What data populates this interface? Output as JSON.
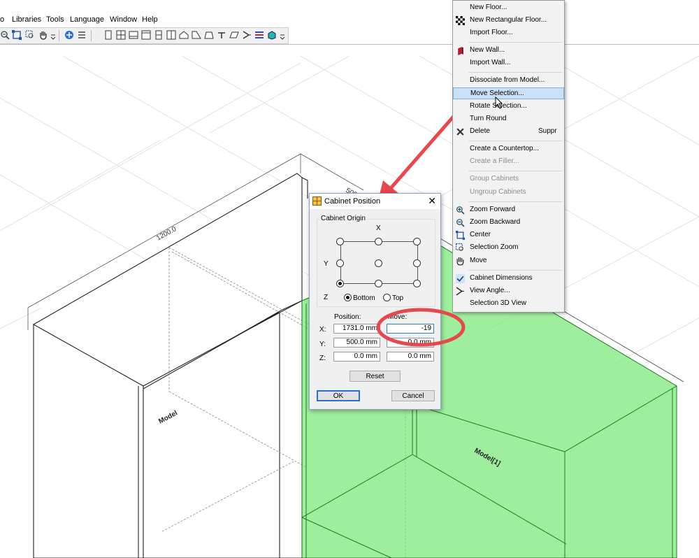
{
  "menubar": {
    "items": [
      "o",
      "Libraries",
      "Tools",
      "Language",
      "Window",
      "Help"
    ]
  },
  "toolbar": {
    "icons": [
      "zoom-out-icon",
      "center-icon",
      "hand-icon",
      "grip-icon",
      "view-icon",
      "list-icon",
      "cabinet-1-icon",
      "cabinet-2-icon",
      "cabinet-3-icon",
      "cabinet-4-icon",
      "cabinet-5-icon",
      "cabinet-6-icon",
      "roof-icon",
      "shape-icon",
      "trapezoid-icon",
      "tap-icon",
      "parallelogram-icon",
      "angle-icon",
      "layers-icon",
      "box-3d-icon",
      "grip2-icon"
    ]
  },
  "canvas": {
    "dim_1200": "1200.0",
    "dim_500": "500.0",
    "model_label": "Model",
    "model1_label": "Model[1]",
    "green_fill": "#7ee87e",
    "annotation_color": "#e5484d"
  },
  "dialog": {
    "title": "Cabinet Position",
    "close": "✕",
    "origin_group": "Cabinet Origin",
    "axis_x": "X",
    "axis_y": "Y",
    "axis_z": "Z",
    "bottom": "Bottom",
    "top": "Top",
    "position_header": "Position:",
    "move_header": "Move:",
    "row_labels": [
      "X:",
      "Y:",
      "Z:"
    ],
    "position_values": [
      "1731.0 mm",
      "500.0 mm",
      "0.0 mm"
    ],
    "move_values": [
      "-19",
      "0.0 mm",
      "0.0 mm"
    ],
    "reset": "Reset",
    "ok": "OK",
    "cancel": "Cancel"
  },
  "menu": {
    "items": [
      {
        "label": "New Floor...",
        "shortcut": "",
        "disabled": false,
        "icon": ""
      },
      {
        "label": "New Rectangular Floor...",
        "shortcut": "",
        "disabled": false,
        "icon": "checker-icon"
      },
      {
        "label": "Import Floor...",
        "shortcut": "",
        "disabled": false,
        "icon": ""
      },
      {
        "label": "New Wall...",
        "shortcut": "",
        "disabled": false,
        "icon": "wall-icon"
      },
      {
        "label": "Import Wall...",
        "shortcut": "",
        "disabled": false,
        "icon": ""
      },
      {
        "label": "Dissociate from Model...",
        "shortcut": "",
        "disabled": false,
        "icon": ""
      },
      {
        "label": "Move Selection...",
        "shortcut": "",
        "disabled": false,
        "icon": ""
      },
      {
        "label": "Rotate Selection...",
        "shortcut": "",
        "disabled": false,
        "icon": ""
      },
      {
        "label": "Turn Round",
        "shortcut": "",
        "disabled": false,
        "icon": ""
      },
      {
        "label": "Delete",
        "shortcut": "Suppr",
        "disabled": false,
        "icon": "delete-icon"
      },
      {
        "label": "Create a Countertop...",
        "shortcut": "",
        "disabled": false,
        "icon": ""
      },
      {
        "label": "Create a Filler...",
        "shortcut": "",
        "disabled": true,
        "icon": ""
      },
      {
        "label": "Group Cabinets",
        "shortcut": "",
        "disabled": true,
        "icon": ""
      },
      {
        "label": "Ungroup Cabinets",
        "shortcut": "",
        "disabled": true,
        "icon": ""
      },
      {
        "label": "Zoom Forward",
        "shortcut": "",
        "disabled": false,
        "icon": "zoom-in-icon"
      },
      {
        "label": "Zoom Backward",
        "shortcut": "",
        "disabled": false,
        "icon": "zoom-out-icon"
      },
      {
        "label": "Center",
        "shortcut": "",
        "disabled": false,
        "icon": "center-icon"
      },
      {
        "label": "Selection Zoom",
        "shortcut": "",
        "disabled": false,
        "icon": "selection-zoom-icon"
      },
      {
        "label": "Move",
        "shortcut": "",
        "disabled": false,
        "icon": "hand-icon"
      },
      {
        "label": "Cabinet Dimensions",
        "shortcut": "",
        "disabled": false,
        "icon": "checkmark-icon"
      },
      {
        "label": "View Angle...",
        "shortcut": "",
        "disabled": false,
        "icon": "view-angle-icon"
      },
      {
        "label": "Selection 3D View",
        "shortcut": "",
        "disabled": false,
        "icon": ""
      }
    ]
  }
}
